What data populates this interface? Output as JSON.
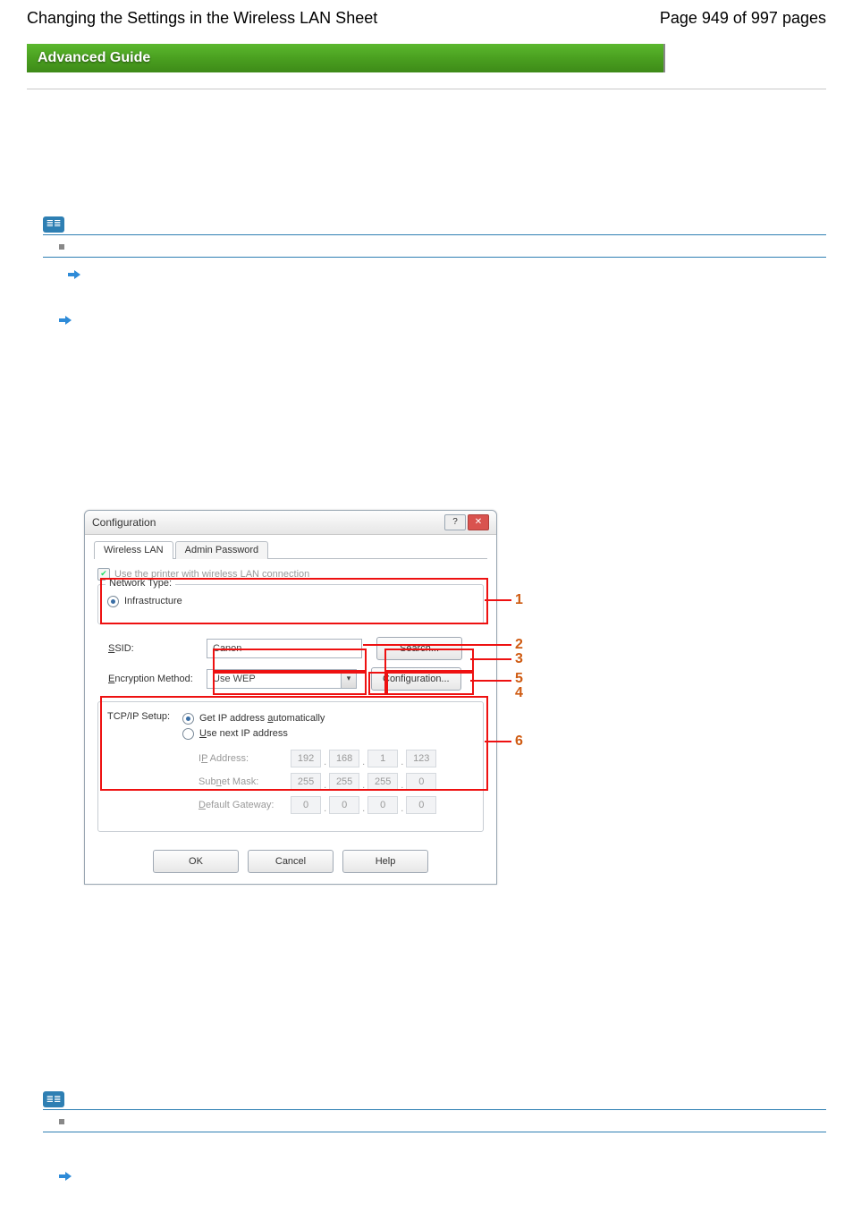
{
  "header": {
    "left": "Changing the Settings in the Wireless LAN Sheet",
    "right": "Page 949 of 997 pages"
  },
  "banner": {
    "title": "Advanced Guide"
  },
  "note_icon_text": "≣≣",
  "dialog": {
    "title": "Configuration",
    "tab_wireless": "Wireless LAN",
    "tab_admin": "Admin Password",
    "use_printer_label": "Use the printer with wireless LAN connection",
    "network_type_label": "Network Type:",
    "infrastructure_label": "Infrastructure",
    "ssid_label": "SSID:",
    "ssid_value": "Canon",
    "search_btn": "Search...",
    "enc_label": "Encryption Method:",
    "enc_value": "Use WEP",
    "config_btn": "Configuration...",
    "tcpip_label": "TCP/IP Setup:",
    "auto_ip_label": "Get IP address automatically",
    "next_ip_label": "Use next IP address",
    "ipaddr_label": "IP Address:",
    "subnet_label": "Subnet Mask:",
    "gateway_label": "Default Gateway:",
    "ip": [
      "192",
      "168",
      "1",
      "123"
    ],
    "subnet": [
      "255",
      "255",
      "255",
      "0"
    ],
    "gw": [
      "0",
      "0",
      "0",
      "0"
    ],
    "ok": "OK",
    "cancel": "Cancel",
    "help": "Help"
  },
  "markers": {
    "m1": "1",
    "m2": "2",
    "m3": "3",
    "m4": "4",
    "m5": "5",
    "m6": "6"
  }
}
